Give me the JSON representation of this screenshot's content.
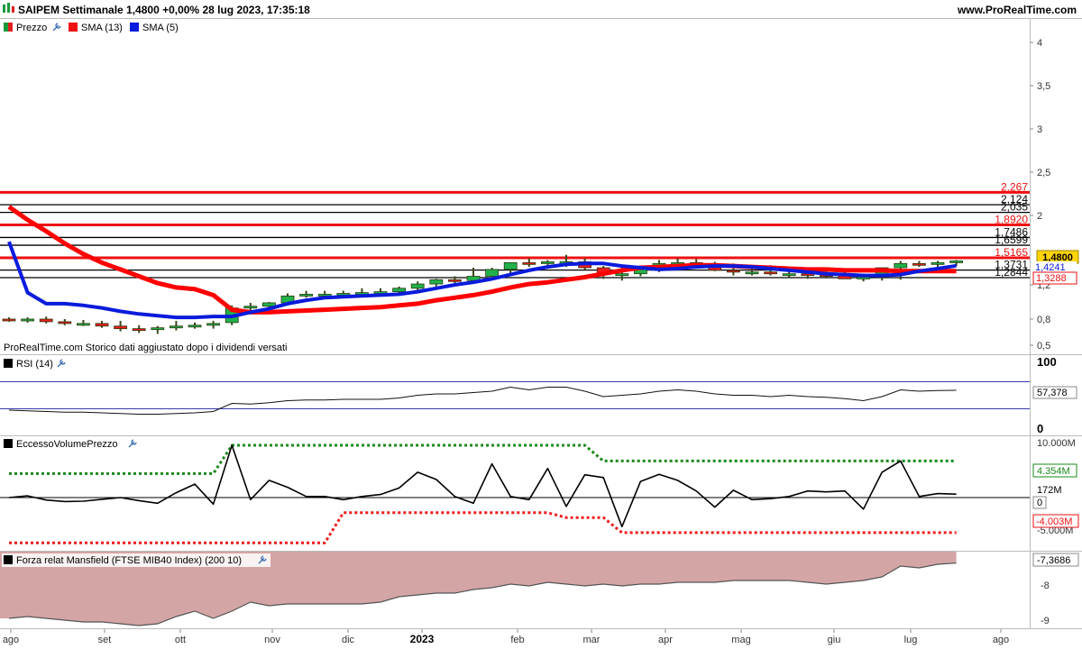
{
  "header": {
    "title": "SAIPEM Settimanale 1,4800 +0,00% 28 lug 2023, 17:35:18",
    "site": "www.ProRealTime.com",
    "note": "ProRealTime.com Storico dati aggiustato dopo i dividendi versati"
  },
  "legend": {
    "price": "Prezzo",
    "sma13": "SMA (13)",
    "sma5": "SMA (5)",
    "rsi": "RSI (14)",
    "volume": "EccessoVolumePrezzo",
    "mansfield": "Forza relat Mansfield (FTSE MIB40 Index) (200 10)"
  },
  "colors": {
    "bull": "#22b14c",
    "bear": "#ee1c1c",
    "sma13": "#ff0000",
    "sma5": "#0a1bdc",
    "rsi_band": "#3a3ab0",
    "volume_up": "#1a8a1a",
    "volume_down": "#ee1c1c",
    "mansfield_fill": "#d4a5a5",
    "price_label_bg": "#ffd400"
  },
  "chart_data": [
    {
      "type": "candlestick",
      "name": "price",
      "period": "weekly",
      "x": [
        "2022-08-01",
        "2022-08-08",
        "2022-08-15",
        "2022-08-22",
        "2022-08-29",
        "2022-09-05",
        "2022-09-12",
        "2022-09-19",
        "2022-09-26",
        "2022-10-03",
        "2022-10-10",
        "2022-10-17",
        "2022-10-24",
        "2022-10-31",
        "2022-11-07",
        "2022-11-14",
        "2022-11-21",
        "2022-11-28",
        "2022-12-05",
        "2022-12-12",
        "2022-12-19",
        "2022-12-26",
        "2023-01-02",
        "2023-01-09",
        "2023-01-16",
        "2023-01-23",
        "2023-01-30",
        "2023-02-06",
        "2023-02-13",
        "2023-02-20",
        "2023-02-27",
        "2023-03-06",
        "2023-03-13",
        "2023-03-20",
        "2023-03-27",
        "2023-04-03",
        "2023-04-10",
        "2023-04-17",
        "2023-04-24",
        "2023-05-01",
        "2023-05-08",
        "2023-05-15",
        "2023-05-22",
        "2023-05-29",
        "2023-06-05",
        "2023-06-12",
        "2023-06-19",
        "2023-06-26",
        "2023-07-03",
        "2023-07-10",
        "2023-07-17",
        "2023-07-24"
      ],
      "open": [
        0.8,
        0.79,
        0.8,
        0.77,
        0.75,
        0.75,
        0.72,
        0.69,
        0.68,
        0.7,
        0.72,
        0.73,
        0.76,
        0.93,
        0.95,
        0.99,
        1.07,
        1.09,
        1.09,
        1.1,
        1.11,
        1.12,
        1.16,
        1.21,
        1.26,
        1.25,
        1.3,
        1.38,
        1.46,
        1.45,
        1.47,
        1.47,
        1.4,
        1.32,
        1.33,
        1.38,
        1.45,
        1.46,
        1.43,
        1.37,
        1.35,
        1.35,
        1.33,
        1.33,
        1.32,
        1.31,
        1.27,
        1.29,
        1.4,
        1.45,
        1.44,
        1.46
      ],
      "high": [
        0.82,
        0.82,
        0.83,
        0.8,
        0.79,
        0.78,
        0.78,
        0.73,
        0.72,
        0.78,
        0.76,
        0.78,
        0.96,
        0.99,
        1.0,
        1.1,
        1.13,
        1.13,
        1.13,
        1.16,
        1.16,
        1.18,
        1.24,
        1.27,
        1.3,
        1.4,
        1.4,
        1.45,
        1.51,
        1.49,
        1.55,
        1.51,
        1.42,
        1.4,
        1.4,
        1.49,
        1.51,
        1.5,
        1.47,
        1.45,
        1.4,
        1.43,
        1.38,
        1.38,
        1.39,
        1.36,
        1.33,
        1.33,
        1.48,
        1.48,
        1.48,
        1.49
      ],
      "low": [
        0.77,
        0.76,
        0.75,
        0.73,
        0.72,
        0.7,
        0.66,
        0.64,
        0.63,
        0.67,
        0.69,
        0.69,
        0.73,
        0.9,
        0.93,
        0.98,
        1.05,
        1.06,
        1.07,
        1.07,
        1.09,
        1.1,
        1.13,
        1.18,
        1.22,
        1.23,
        1.29,
        1.33,
        1.41,
        1.43,
        1.41,
        1.38,
        1.27,
        1.25,
        1.3,
        1.35,
        1.39,
        1.4,
        1.36,
        1.31,
        1.31,
        1.31,
        1.29,
        1.27,
        1.29,
        1.28,
        1.24,
        1.25,
        1.26,
        1.41,
        1.4,
        1.42
      ],
      "close": [
        0.79,
        0.8,
        0.77,
        0.75,
        0.75,
        0.72,
        0.69,
        0.68,
        0.7,
        0.72,
        0.73,
        0.75,
        0.93,
        0.95,
        0.99,
        1.07,
        1.09,
        1.09,
        1.1,
        1.11,
        1.12,
        1.16,
        1.21,
        1.26,
        1.25,
        1.3,
        1.38,
        1.46,
        1.45,
        1.47,
        1.47,
        1.4,
        1.32,
        1.33,
        1.38,
        1.45,
        1.46,
        1.43,
        1.37,
        1.35,
        1.35,
        1.33,
        1.33,
        1.32,
        1.31,
        1.27,
        1.29,
        1.4,
        1.45,
        1.44,
        1.46,
        1.48
      ]
    },
    {
      "type": "line",
      "name": "SMA (13)",
      "values": [
        2.1,
        1.95,
        1.82,
        1.68,
        1.56,
        1.46,
        1.38,
        1.3,
        1.22,
        1.17,
        1.15,
        1.08,
        0.91,
        0.88,
        0.88,
        0.89,
        0.9,
        0.91,
        0.92,
        0.93,
        0.94,
        0.96,
        0.98,
        1.02,
        1.05,
        1.08,
        1.12,
        1.17,
        1.21,
        1.23,
        1.26,
        1.29,
        1.33,
        1.37,
        1.4,
        1.41,
        1.42,
        1.43,
        1.43,
        1.42,
        1.41,
        1.4,
        1.39,
        1.38,
        1.38,
        1.37,
        1.37,
        1.37,
        1.36,
        1.36,
        1.36,
        1.36
      ]
    },
    {
      "type": "line",
      "name": "SMA (5)",
      "values": [
        1.7,
        1.11,
        0.98,
        0.98,
        0.96,
        0.93,
        0.89,
        0.86,
        0.84,
        0.82,
        0.82,
        0.83,
        0.83,
        0.88,
        0.92,
        0.98,
        1.02,
        1.05,
        1.06,
        1.07,
        1.08,
        1.09,
        1.12,
        1.16,
        1.2,
        1.23,
        1.27,
        1.32,
        1.37,
        1.41,
        1.44,
        1.45,
        1.45,
        1.42,
        1.4,
        1.38,
        1.39,
        1.41,
        1.42,
        1.42,
        1.41,
        1.39,
        1.37,
        1.35,
        1.33,
        1.32,
        1.31,
        1.31,
        1.32,
        1.36,
        1.39,
        1.4241
      ]
    },
    {
      "type": "line",
      "name": "RSI (14)",
      "ylim": [
        0,
        100
      ],
      "bands": [
        70,
        30
      ],
      "values": [
        28,
        27,
        26,
        25,
        25,
        24,
        23,
        22,
        22,
        23,
        24,
        26,
        38,
        37,
        39,
        42,
        43,
        43,
        44,
        44,
        44,
        46,
        50,
        52,
        52,
        54,
        56,
        62,
        58,
        62,
        62,
        56,
        48,
        50,
        52,
        56,
        58,
        56,
        52,
        50,
        50,
        48,
        50,
        48,
        47,
        45,
        42,
        48,
        58,
        56,
        57,
        57.378
      ]
    },
    {
      "type": "line",
      "name": "EccessoVolumePrezzo",
      "values": [
        0,
        0.08,
        -0.12,
        -0.2,
        -0.18,
        -0.08,
        0,
        -0.15,
        -0.3,
        0.25,
        0.85,
        -0.35,
        10.0,
        -0.1,
        1.2,
        0.6,
        0.05,
        0.05,
        -0.1,
        0.05,
        0.15,
        0.55,
        2.2,
        1.3,
        0.05,
        -0.3,
        3.7,
        0.05,
        -0.1,
        2.8,
        -0.5,
        1.85,
        1.5,
        -2.8,
        1.1,
        1.9,
        1.2,
        0.35,
        -0.55,
        0.4,
        -0.1,
        -0.05,
        0.05,
        0.35,
        0.3,
        0.35,
        -0.7,
        2.2,
        4.354,
        0.05,
        0.2,
        0.172
      ],
      "upper_band": [
        2.0,
        2.0,
        2.0,
        2.0,
        2.0,
        2.0,
        2.0,
        2.0,
        2.0,
        2.0,
        2.0,
        2.0,
        10.0,
        10.0,
        10.0,
        10.0,
        10.0,
        10.0,
        10.0,
        10.0,
        10.0,
        10.0,
        10.0,
        10.0,
        10.0,
        10.0,
        10.0,
        10.0,
        10.0,
        10.0,
        10.0,
        10.0,
        4.354,
        4.354,
        4.354,
        4.354,
        4.354,
        4.354,
        4.354,
        4.354,
        4.354,
        4.354,
        4.354,
        4.354,
        4.354,
        4.354,
        4.354,
        4.354,
        4.354,
        4.354,
        4.354,
        4.354
      ],
      "lower_band": [
        -7.0,
        -7.0,
        -7.0,
        -7.0,
        -7.0,
        -7.0,
        -7.0,
        -7.0,
        -7.0,
        -7.0,
        -7.0,
        -7.0,
        -7.0,
        -7.0,
        -7.0,
        -7.0,
        -7.0,
        -7.0,
        -1.0,
        -1.0,
        -1.0,
        -1.0,
        -1.0,
        -1.0,
        -1.0,
        -1.0,
        -1.0,
        -1.0,
        -1.0,
        -1.0,
        -1.5,
        -1.5,
        -1.5,
        -4.003,
        -4.003,
        -4.003,
        -4.003,
        -4.003,
        -4.003,
        -4.003,
        -4.003,
        -4.003,
        -4.003,
        -4.003,
        -4.003,
        -4.003,
        -4.003,
        -4.003,
        -4.003,
        -4.003,
        -4.003,
        -4.003
      ]
    },
    {
      "type": "area",
      "name": "Forza relat Mansfield",
      "values": [
        -8.9,
        -8.85,
        -8.9,
        -8.95,
        -9.0,
        -9.0,
        -9.05,
        -9.1,
        -9.05,
        -8.85,
        -8.7,
        -8.9,
        -8.7,
        -8.45,
        -8.55,
        -8.5,
        -8.5,
        -8.5,
        -8.5,
        -8.5,
        -8.45,
        -8.3,
        -8.25,
        -8.2,
        -8.2,
        -8.1,
        -8.05,
        -7.95,
        -8.0,
        -7.9,
        -7.95,
        -8.0,
        -7.95,
        -8.0,
        -7.95,
        -7.95,
        -7.9,
        -7.9,
        -7.9,
        -7.85,
        -7.85,
        -7.85,
        -7.85,
        -7.9,
        -7.95,
        -7.9,
        -7.85,
        -7.75,
        -7.45,
        -7.5,
        -7.4,
        -7.3686
      ]
    }
  ],
  "levels": [
    {
      "value": 2.267,
      "label": "2,267",
      "color": "#ee1111",
      "style": "thick"
    },
    {
      "value": 2.124,
      "label": "2,124",
      "color": "#000000",
      "style": "thin"
    },
    {
      "value": 2.035,
      "label": "2,035",
      "color": "#000000",
      "style": "thin"
    },
    {
      "value": 1.892,
      "label": "1,8920",
      "color": "#ee1111",
      "style": "thick"
    },
    {
      "value": 1.7486,
      "label": "1,7486",
      "color": "#000000",
      "style": "thin"
    },
    {
      "value": 1.6599,
      "label": "1,6599",
      "color": "#000000",
      "style": "thin"
    },
    {
      "value": 1.5165,
      "label": "1,5165",
      "color": "#ee1111",
      "style": "thick"
    },
    {
      "value": 1.3731,
      "label": "1,3731",
      "color": "#000000",
      "style": "thin"
    },
    {
      "value": 1.2844,
      "label": "1,2844",
      "color": "#000000",
      "style": "thin"
    }
  ],
  "axes": {
    "price_ticks": [
      "4",
      "3,5",
      "3",
      "2,5",
      "2",
      "1,2",
      "0,8",
      "0,5"
    ],
    "price_tick_values": [
      4,
      3.5,
      3,
      2.5,
      2,
      1.2,
      0.8,
      0.5
    ],
    "rsi_ticks": [
      "100",
      "0"
    ],
    "volume_ticks": [
      "10.000M",
      "0",
      "-5.000M"
    ],
    "mansfield_ticks": [
      "-8",
      "-9"
    ],
    "x_labels": [
      "ago",
      "set",
      "ott",
      "nov",
      "dic",
      "2023",
      "feb",
      "mar",
      "apr",
      "mag",
      "giu",
      "lug",
      "ago"
    ]
  },
  "value_labels": {
    "price": "1,4800",
    "sma5": "1,4241",
    "sma13": "1,3288",
    "rsi": "57,378",
    "vol_upper": "4.354M",
    "vol_last": "172M",
    "vol_zero": "0",
    "vol_lower": "-4.003M",
    "mansfield": "-7,3686"
  }
}
